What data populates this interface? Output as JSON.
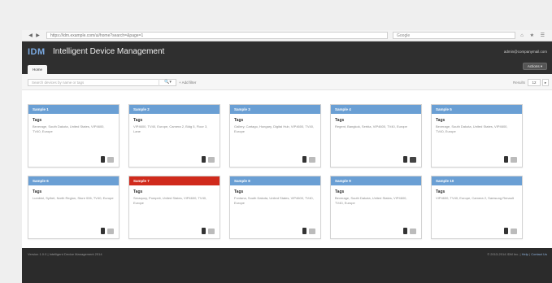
{
  "browser": {
    "back": "◀",
    "forward": "▶",
    "url": "https://idm.example.com/ui/home?search=&page=1",
    "search_box": "Google",
    "icons": "⌂ ★ ☰"
  },
  "app": {
    "logo": "IDM",
    "title": "Intelligent Device Management",
    "user_email": "admin@companymail.com",
    "home_tab": "Home",
    "actions_button": "Actions ▾"
  },
  "toolbar": {
    "search_placeholder": "Search devices by name or tags",
    "search_icon": "search-icon",
    "search_glyph": "🔍▾",
    "add_filter": "+ Add filter",
    "results_label": "Results",
    "per_page": "12",
    "next": "▸"
  },
  "cards": [
    {
      "title": "Sample 1",
      "tags_label": "Tags",
      "tags": "Beverage, South Dakota, United States, VIP4600, TV40, Europe",
      "alert": false,
      "camera": "light"
    },
    {
      "title": "Sample 2",
      "tags_label": "Tags",
      "tags": "VIP4600, TV40, Europe, Camera 2, Bldg 5, Floor 3, Lane",
      "alert": false,
      "camera": "light"
    },
    {
      "title": "Sample 3",
      "tags_label": "Tags",
      "tags": "Gallery, Cartago, Hungary, Digital Hub, VIP4600, TV40, Europe",
      "alert": false,
      "camera": "light"
    },
    {
      "title": "Sample 4",
      "tags_label": "Tags",
      "tags": "Regent, Bangkok, Serbia, VIP4600, TV40, Europe",
      "alert": false,
      "camera": "dark"
    },
    {
      "title": "Sample 5",
      "tags_label": "Tags",
      "tags": "Beverage, South Dakota, United States, VIP4600, TV40, Europe",
      "alert": false,
      "camera": "light"
    },
    {
      "title": "Sample 6",
      "tags_label": "Tags",
      "tags": "Lumbini, Sylhet, North Region, Store 006, TV40, Europe",
      "alert": false,
      "camera": "light"
    },
    {
      "title": "Sample 7",
      "tags_label": "Tags",
      "tags": "Seraquoy, Pompeii, United States, VIP4600, TV40, Europe",
      "alert": true,
      "camera": "light"
    },
    {
      "title": "Sample 8",
      "tags_label": "Tags",
      "tags": "Fontana, South Dakota, United States, VIP4600, TV40, Europe",
      "alert": false,
      "camera": "light"
    },
    {
      "title": "Sample 9",
      "tags_label": "Tags",
      "tags": "Beverage, South Dakota, United States, VIP4600, TV40, Europe",
      "alert": false,
      "camera": "light"
    },
    {
      "title": "Sample 10",
      "tags_label": "Tags",
      "tags": "VIP4600, TV40, Europe, Camera 2, Samsung Renault",
      "alert": false,
      "camera": "light"
    }
  ],
  "footer": {
    "left": "Version 1.0.0  |  Intelligent Device Management 2014",
    "right_text": "© 2013-2014 IDM Inc.  |",
    "help_link": "Help",
    "contact_link": "Contact Us"
  },
  "colors": {
    "card_header": "#6a9fd4",
    "alert_header": "#d02a1c",
    "appbar": "#2f2f2f",
    "footer": "#2b2b2b"
  }
}
